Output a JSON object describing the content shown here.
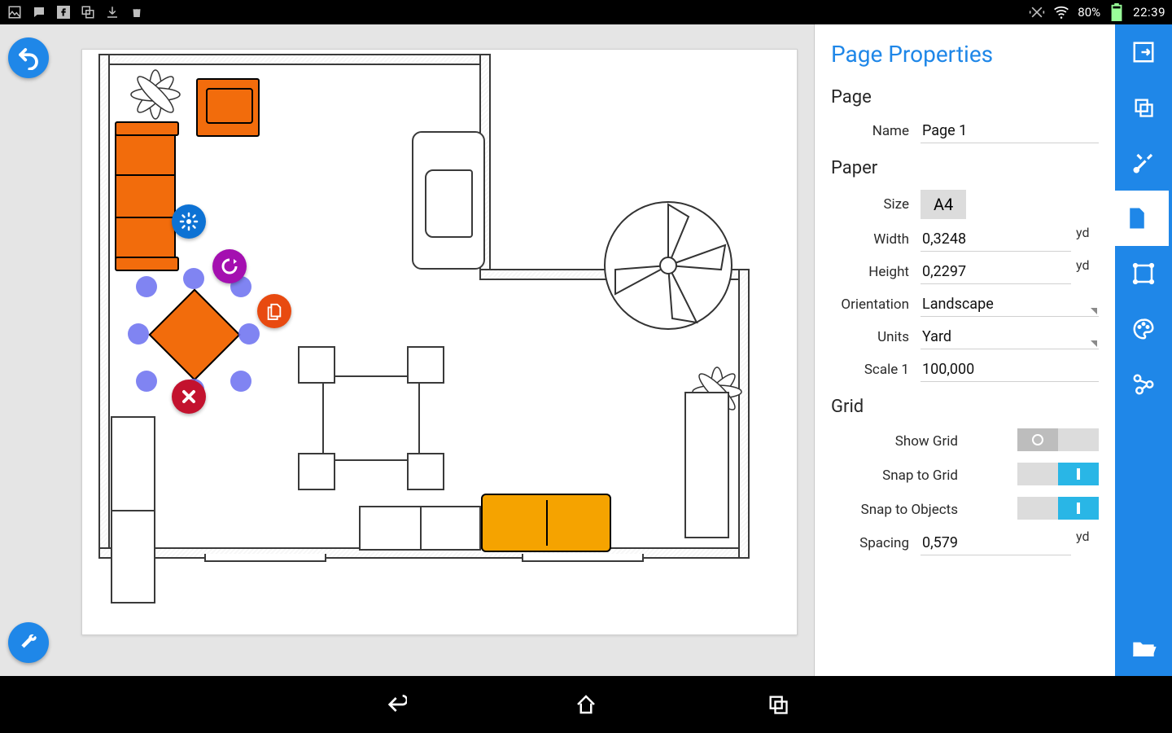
{
  "status": {
    "battery_pct": "80%",
    "clock": "22:39"
  },
  "panel": {
    "title": "Page Properties",
    "sections": {
      "page": {
        "heading": "Page",
        "name_label": "Name",
        "name_value": "Page 1"
      },
      "paper": {
        "heading": "Paper",
        "size_label": "Size",
        "size_value": "A4",
        "width_label": "Width",
        "width_value": "0,3248",
        "width_unit": "yd",
        "height_label": "Height",
        "height_value": "0,2297",
        "height_unit": "yd",
        "orient_label": "Orientation",
        "orient_value": "Landscape",
        "units_label": "Units",
        "units_value": "Yard",
        "scale_label": "Scale 1",
        "scale_value": "100,000"
      },
      "grid": {
        "heading": "Grid",
        "show_label": "Show Grid",
        "show_on": false,
        "snapg_label": "Snap to Grid",
        "snapg_on": true,
        "snapo_label": "Snap to Objects",
        "snapo_on": true,
        "spacing_label": "Spacing",
        "spacing_value": "0,579",
        "spacing_unit": "yd"
      }
    }
  },
  "rail": {
    "tools": [
      "export",
      "copy",
      "tools",
      "page",
      "shapehandles",
      "palette",
      "connection",
      "open"
    ],
    "active": "page"
  },
  "context_actions": [
    "settings",
    "rotate",
    "copy",
    "delete"
  ]
}
